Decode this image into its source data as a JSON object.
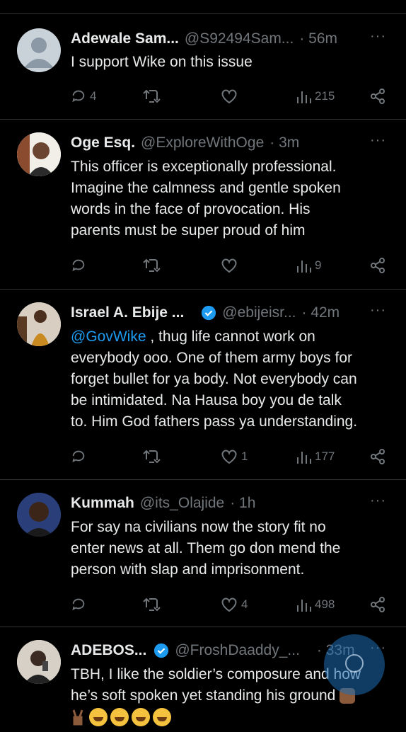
{
  "colors": {
    "background": "#000000",
    "text": "#e7e9ea",
    "muted": "#71767b",
    "link": "#1d9bf0",
    "verified": "#1d9bf0"
  },
  "tweets": [
    {
      "name": "Adewale Sam...",
      "handle": "@S92494Sam...",
      "time": "· 56m",
      "more": "···",
      "lines": [
        "I support Wike on this issue"
      ],
      "replies": "4",
      "retweets": "",
      "likes": "",
      "views": "215",
      "verified": false,
      "avatar_icon": "default-avatar-icon"
    },
    {
      "name": "Oge Esq.",
      "handle": "@ExploreWithOge",
      "time": "· 3m",
      "more": "···",
      "lines": [
        "This officer is exceptionally professional.",
        "Imagine the calmness and gentle spoken",
        "words in the face of provocation. His",
        "parents must be super proud of him"
      ],
      "replies": "",
      "retweets": "",
      "likes": "",
      "views": "9",
      "verified": false,
      "avatar_icon": "user-photo-avatar"
    },
    {
      "name": "Israel A. Ebije ...",
      "handle": "@ebijeisr...",
      "time": "· 42m",
      "more": "···",
      "mention": "@GovWike",
      "lines": [
        " , thug life cannot work on",
        "everybody ooo. One of them army boys for",
        "forget bullet for ya body. Not everybody can",
        "be intimidated. Na Hausa boy you de talk",
        "to. Him God fathers pass ya understanding."
      ],
      "replies": "",
      "retweets": "",
      "likes": "1",
      "views": "177",
      "verified": true,
      "avatar_icon": "user-photo-avatar"
    },
    {
      "name": "Kummah",
      "handle": "@its_Olajide",
      "time": "· 1h",
      "more": "···",
      "lines": [
        "For say na civilians now the story fit no",
        "enter news at all. Them go don mend the",
        "person with slap and imprisonment."
      ],
      "replies": "",
      "retweets": "",
      "likes": "4",
      "views": "498",
      "verified": false,
      "avatar_icon": "user-photo-avatar"
    },
    {
      "name": "ADEBOS...",
      "handle": "@FroshDaaddy_...",
      "time": "· 33m",
      "more": "···",
      "lines": [
        "TBH, I like the soldier’s composure and how",
        "he’s soft spoken yet standing his ground"
      ],
      "verified": true,
      "avatar_icon": "user-photo-avatar"
    }
  ]
}
